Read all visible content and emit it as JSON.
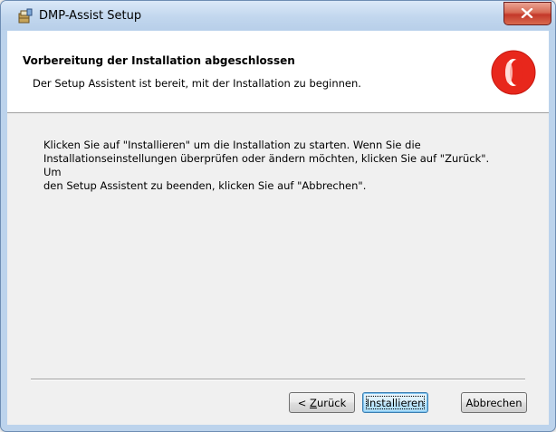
{
  "window": {
    "title": "DMP-Assist Setup",
    "title_icon": "installer-package-icon",
    "close_icon": "close-icon"
  },
  "header": {
    "title": "Vorbereitung der Installation abgeschlossen",
    "subtitle": "Der Setup Assistent ist bereit, mit der Installation zu beginnen.",
    "logo": "red-circle-logo"
  },
  "body": {
    "lines": [
      "Klicken Sie auf \"Installieren\" um die Installation zu starten. Wenn Sie die",
      "Installationseinstellungen überprüfen oder ändern möchten, klicken Sie auf \"Zurück\". Um",
      "den Setup Assistent zu beenden, klicken Sie auf \"Abbrechen\"."
    ]
  },
  "buttons": {
    "back_prefix": "< ",
    "back_accel": "Z",
    "back_rest": "urück",
    "install": "Installieren",
    "cancel": "Abbrechen"
  },
  "colors": {
    "close_button": "#c4382a",
    "logo_red": "#e8271c",
    "default_button_border": "#3c7fb1"
  }
}
